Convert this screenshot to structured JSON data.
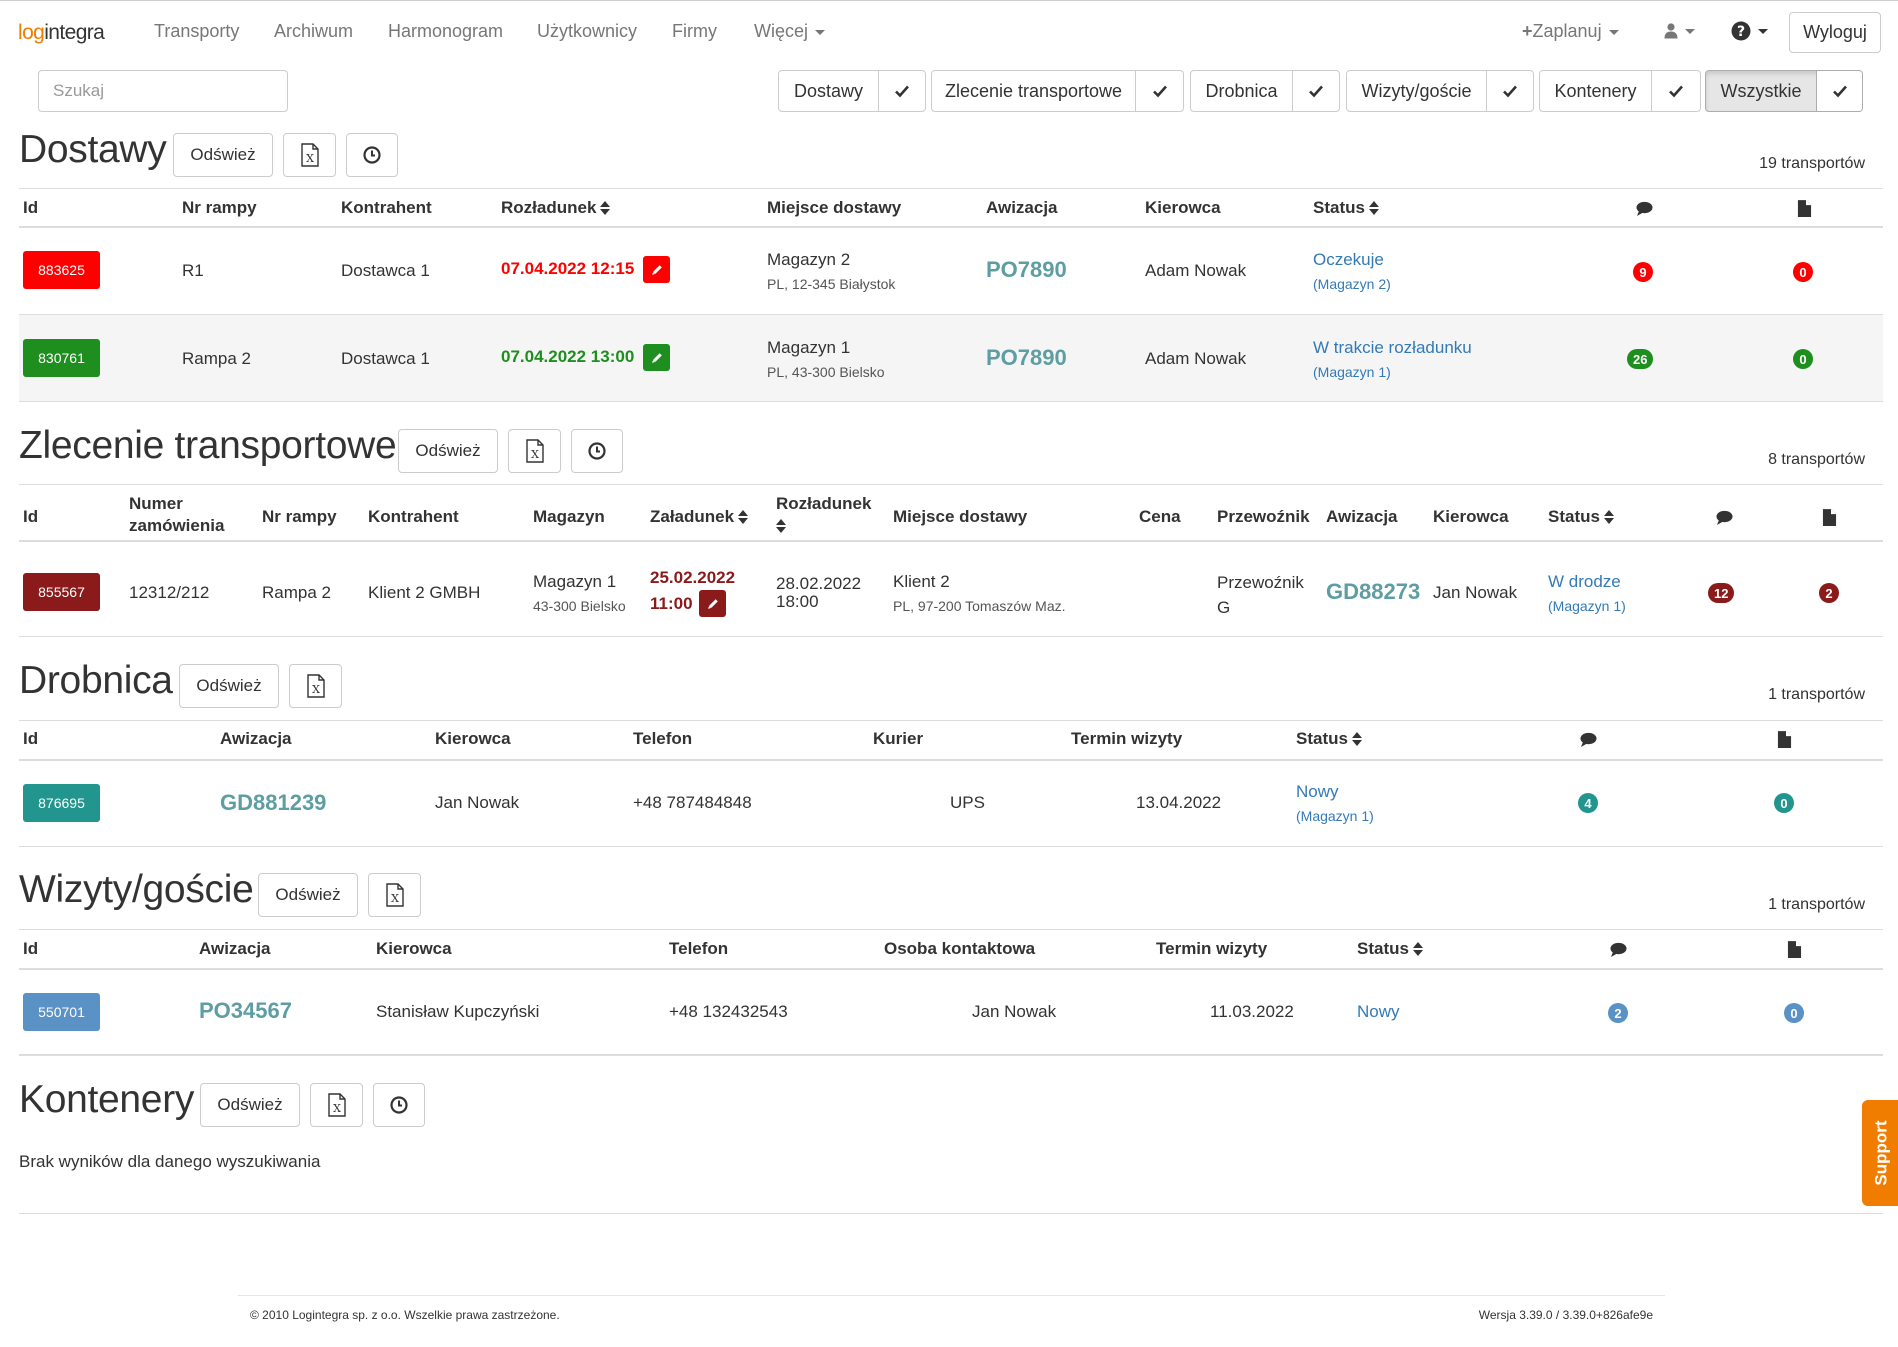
{
  "header": {
    "logo_main": "log",
    "logo_rest": "integra",
    "nav": [
      "Transporty",
      "Archiwum",
      "Harmonogram",
      "Użytkownicy",
      "Firmy",
      "Więcej"
    ],
    "plan_label": "Zaplanuj",
    "logout_label": "Wyloguj"
  },
  "search": {
    "placeholder": "Szukaj",
    "value": ""
  },
  "filters": [
    {
      "label": "Dostawy",
      "checked": true,
      "active": false
    },
    {
      "label": "Zlecenie transportowe",
      "checked": true,
      "active": false
    },
    {
      "label": "Drobnica",
      "checked": true,
      "active": false
    },
    {
      "label": "Wizyty/goście",
      "checked": true,
      "active": false
    },
    {
      "label": "Kontenery",
      "checked": true,
      "active": false
    },
    {
      "label": "Wszystkie",
      "checked": true,
      "active": true
    }
  ],
  "colors": {
    "red": "#ff0000",
    "green": "#1e8f1e",
    "darkred": "#8b1a1a",
    "teal": "#22968e",
    "blue": "#5a92c6",
    "link": "#337ab7",
    "awizacja": "#5e9ea3",
    "support": "#f07d00"
  },
  "dostawy": {
    "title": "Dostawy",
    "refresh_label": "Odśwież",
    "count": "19 transportów",
    "headers": [
      "Id",
      "Nr rampy",
      "Kontrahent",
      "Rozładunek",
      "Miejsce dostawy",
      "Awizacja",
      "Kierowca",
      "Status"
    ],
    "rows": [
      {
        "id": "883625",
        "id_color": "red",
        "ramp": "R1",
        "contractor": "Dostawca 1",
        "unload": "07.04.2022 12:15",
        "place": "Magazyn 2",
        "place_sub": "PL, 12-345 Białystok",
        "awiz": "PO7890",
        "driver": "Adam Nowak",
        "status": "Oczekuje",
        "status_sub": "(Magazyn 2)",
        "comments": "9",
        "docs": "0"
      },
      {
        "id": "830761",
        "id_color": "green",
        "ramp": "Rampa 2",
        "contractor": "Dostawca 1",
        "unload": "07.04.2022 13:00",
        "place": "Magazyn 1",
        "place_sub": "PL, 43-300 Bielsko",
        "awiz": "PO7890",
        "driver": "Adam Nowak",
        "status": "W trakcie rozładunku",
        "status_sub": "(Magazyn 1)",
        "comments": "26",
        "docs": "0"
      }
    ]
  },
  "zlecenie": {
    "title": "Zlecenie transportowe",
    "refresh_label": "Odśwież",
    "count": "8 transportów",
    "headers": {
      "id": "Id",
      "order_1": "Numer",
      "order_2": "zamówienia",
      "ramp": "Nr rampy",
      "contractor": "Kontrahent",
      "warehouse": "Magazyn",
      "load": "Załadunek",
      "unload": "Rozładunek",
      "place": "Miejsce dostawy",
      "price": "Cena",
      "carrier": "Przewoźnik",
      "awiz": "Awizacja",
      "driver": "Kierowca",
      "status": "Status"
    },
    "row": {
      "id": "855567",
      "order": "12312/212",
      "ramp": "Rampa 2",
      "contractor": "Klient 2 GMBH",
      "warehouse": "Magazyn 1",
      "warehouse_sub": "43-300 Bielsko",
      "load_date": "25.02.2022",
      "load_time": "11:00",
      "unload_date": "28.02.2022",
      "unload_time": "18:00",
      "place": "Klient 2",
      "place_sub": "PL, 97-200 Tomaszów Maz.",
      "price": "",
      "carrier_1": "Przewoźnik",
      "carrier_2": "G",
      "awiz": "GD88273",
      "driver": "Jan Nowak",
      "status": "W drodze",
      "status_sub": "(Magazyn 1)",
      "comments": "12",
      "docs": "2"
    }
  },
  "drobnica": {
    "title": "Drobnica",
    "refresh_label": "Odśwież",
    "count": "1 transportów",
    "headers": {
      "id": "Id",
      "awiz": "Awizacja",
      "driver": "Kierowca",
      "phone": "Telefon",
      "courier": "Kurier",
      "visit": "Termin wizyty",
      "status": "Status"
    },
    "row": {
      "id": "876695",
      "awiz": "GD881239",
      "driver": "Jan Nowak",
      "phone": "+48 787484848",
      "courier": "UPS",
      "visit": "13.04.2022",
      "status": "Nowy",
      "status_sub": "(Magazyn 1)",
      "comments": "4",
      "docs": "0"
    }
  },
  "wizyty": {
    "title": "Wizyty/goście",
    "refresh_label": "Odśwież",
    "count": "1 transportów",
    "headers": {
      "id": "Id",
      "awiz": "Awizacja",
      "driver": "Kierowca",
      "phone": "Telefon",
      "contact": "Osoba kontaktowa",
      "visit": "Termin wizyty",
      "status": "Status"
    },
    "row": {
      "id": "550701",
      "awiz": "PO34567",
      "driver": "Stanisław Kupczyński",
      "phone": "+48 132432543",
      "contact": "Jan Nowak",
      "visit": "11.03.2022",
      "status": "Nowy",
      "comments": "2",
      "docs": "0"
    }
  },
  "kontenery": {
    "title": "Kontenery",
    "refresh_label": "Odśwież",
    "empty_text": "Brak wyników dla danego wyszukiwania"
  },
  "footer": {
    "copyright": "© 2010 Logintegra sp. z o.o. Wszelkie prawa zastrzeżone.",
    "version": "Wersja 3.39.0 / 3.39.0+826afe9e"
  },
  "support_label": "Support"
}
